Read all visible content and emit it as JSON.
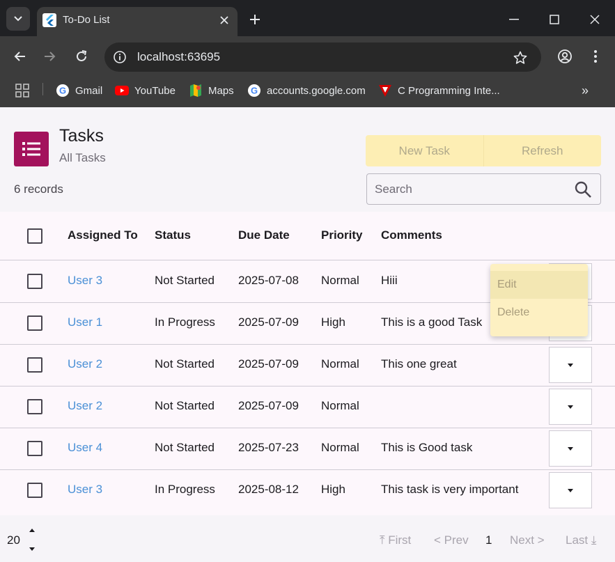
{
  "browser": {
    "tab_title": "To-Do List",
    "url": "localhost:63695",
    "bookmarks": [
      {
        "label": "Gmail",
        "icon": "google-icon"
      },
      {
        "label": "YouTube",
        "icon": "youtube-icon"
      },
      {
        "label": "Maps",
        "icon": "maps-icon"
      },
      {
        "label": "accounts.google.com",
        "icon": "google-icon"
      },
      {
        "label": "C Programming Inte...",
        "icon": "c-programming-icon"
      }
    ],
    "more_bookmarks": "»"
  },
  "app": {
    "title": "Tasks",
    "subtitle": "All Tasks",
    "records": "6 records",
    "new_task_label": "New Task",
    "refresh_label": "Refresh",
    "search_placeholder": "Search",
    "accent_color": "#a3125c",
    "button_color": "#fdeeb4"
  },
  "table": {
    "columns": [
      "Assigned To",
      "Status",
      "Due Date",
      "Priority",
      "Comments"
    ],
    "rows": [
      {
        "assigned": "User 3",
        "status": "Not Started",
        "due": "2025-07-08",
        "priority": "Normal",
        "comments": "Hiii"
      },
      {
        "assigned": "User 1",
        "status": "In Progress",
        "due": "2025-07-09",
        "priority": "High",
        "comments": "This is a good Task"
      },
      {
        "assigned": "User 2",
        "status": "Not Started",
        "due": "2025-07-09",
        "priority": "Normal",
        "comments": "This one great"
      },
      {
        "assigned": "User 2",
        "status": "Not Started",
        "due": "2025-07-09",
        "priority": "Normal",
        "comments": ""
      },
      {
        "assigned": "User 4",
        "status": "Not Started",
        "due": "2025-07-23",
        "priority": "Normal",
        "comments": "This is Good task"
      },
      {
        "assigned": "User 3",
        "status": "In Progress",
        "due": "2025-08-12",
        "priority": "High",
        "comments": "This task is very important"
      }
    ]
  },
  "row_menu": {
    "items": [
      "Edit",
      "Delete"
    ]
  },
  "pagination": {
    "per_page": "20",
    "first": "⤒ First",
    "prev": "< Prev",
    "current": "1",
    "next": "Next >",
    "last": "Last ⤓"
  }
}
